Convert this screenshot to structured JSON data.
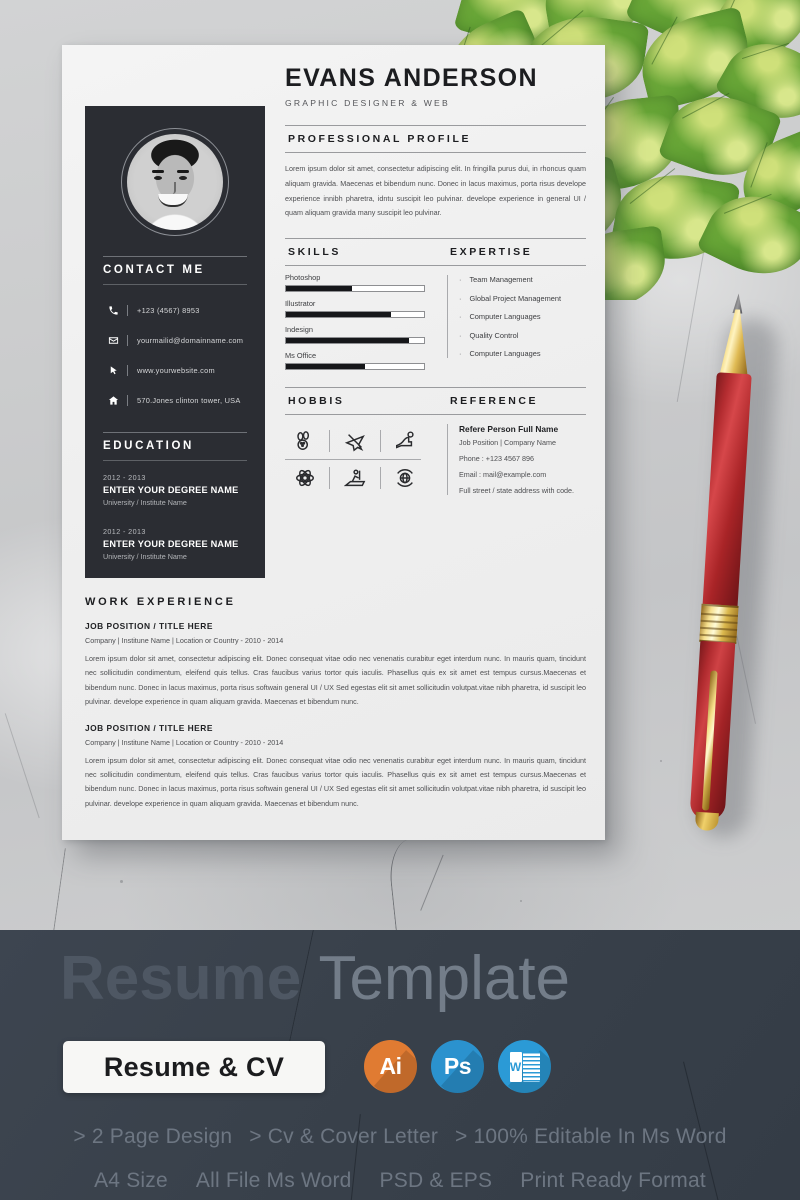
{
  "resume": {
    "header": {
      "name": "EVANS ANDERSON",
      "subtitle": "GRAPHIC DESIGNER & WEB"
    },
    "profile": {
      "title": "PROFESSIONAL PROFILE",
      "text": "Lorem ipsum dolor sit amet, consectetur adipiscing elit. In fringilla purus dui, in rhoncus quam aliquam gravida. Maecenas et bibendum nunc. Donec in lacus maximus, porta risus develope experience innibh pharetra, idntu suscipit leo pulvinar. develope experience in general UI /  quam aliquam gravida many suscipit leo pulvinar."
    },
    "contact": {
      "title": "CONTACT ME",
      "items": [
        {
          "icon": "phone-icon",
          "value": "+123 (4567) 8953"
        },
        {
          "icon": "envelope-icon",
          "value": "yourmailid@domainname.com"
        },
        {
          "icon": "cursor-icon",
          "value": "www.yourwebsite.com"
        },
        {
          "icon": "home-icon",
          "value": "570.Jones clinton tower, USA"
        }
      ]
    },
    "education": {
      "title": "EDUCATION",
      "items": [
        {
          "years": "2012 - 2013",
          "degree": "ENTER YOUR DEGREE NAME",
          "school": "University / Institute Name"
        },
        {
          "years": "2012 - 2013",
          "degree": "ENTER YOUR DEGREE NAME",
          "school": "University / Institute Name"
        }
      ]
    },
    "skills": {
      "title": "SKILLS",
      "items": [
        {
          "name": "Photoshop",
          "percent": 48
        },
        {
          "name": "Illustrator",
          "percent": 76
        },
        {
          "name": "Indesign",
          "percent": 89
        },
        {
          "name": "Ms Office",
          "percent": 57
        }
      ]
    },
    "expertise": {
      "title": "EXPERTISE",
      "items": [
        "Team Management",
        "Global Project Management",
        "Computer Languages",
        "Quality Control",
        "Computer Languages"
      ]
    },
    "hobbies": {
      "title": "HOBBIS",
      "icons": [
        "bowling-icon",
        "airplane-icon",
        "high-heel-icon",
        "atom-icon",
        "treadmill-icon",
        "globe-recycle-icon"
      ]
    },
    "reference": {
      "title": "REFERENCE",
      "name": "Refere Person Full Name",
      "position": "Job Position | Company Name",
      "phone": "Phone : +123 4567 896",
      "email": "Email : mail@example.com",
      "address": "Full street / state address with code."
    },
    "work": {
      "title": "WORK EXPERIENCE",
      "jobs": [
        {
          "title": "JOB POSITION / TITLE HERE",
          "meta": "Company | Institune Name | Location or Country - 2010 - 2014",
          "desc": "Lorem ipsum dolor sit amet, consectetur adipiscing elit. Donec consequat vitae odio nec venenatis curabitur eget interdum nunc. In mauris quam, tincidunt nec sollicitudin condimentum, eleifend quis tellus. Cras faucibus varius tortor quis iaculis. Phasellus quis ex sit amet est tempus cursus.Maecenas et bibendum nunc. Donec in lacus maximus, porta risus softwain general UI / UX Sed egestas elit sit amet sollicitudin volutpat.vitae nibh pharetra, id suscipit leo pulvinar. develope experience in quam aliquam gravida. Maecenas et bibendum nunc."
        },
        {
          "title": "JOB POSITION / TITLE HERE",
          "meta": "Company | Institune Name | Location or Country - 2010 - 2014",
          "desc": "Lorem ipsum dolor sit amet, consectetur adipiscing elit. Donec consequat vitae odio nec venenatis curabitur eget interdum nunc. In mauris quam, tincidunt nec sollicitudin condimentum, eleifend quis tellus. Cras faucibus varius tortor quis iaculis. Phasellus quis ex sit amet est tempus cursus.Maecenas et bibendum nunc. Donec in lacus maximus, porta risus softwain general UI / UX Sed egestas elit sit amet sollicitudin volutpat.vitae nibh pharetra, id suscipit leo pulvinar. develope experience in quam aliquam gravida. Maecenas et bibendum nunc."
        }
      ]
    }
  },
  "banner": {
    "headline_bold": "Resume",
    "headline_light": "Template",
    "badge": "Resume & CV",
    "apps": [
      {
        "name": "illustrator-icon",
        "label": "Ai"
      },
      {
        "name": "photoshop-icon",
        "label": "Ps"
      },
      {
        "name": "word-icon",
        "label": "W"
      }
    ],
    "features_row1": [
      "> 2 Page Design",
      "> Cv & Cover Letter",
      "> 100% Editable In Ms Word"
    ],
    "features_row2": [
      "A4 Size",
      "All File Ms Word",
      "PSD & EPS",
      "Print Ready Format"
    ]
  },
  "colors": {
    "sidebar": "#2b2d33",
    "banner": "#39414b",
    "accent_ai": "#e07b32",
    "accent_ps": "#2b92ce",
    "accent_word": "#2b9ad6",
    "skill_fill": "#16171a"
  }
}
